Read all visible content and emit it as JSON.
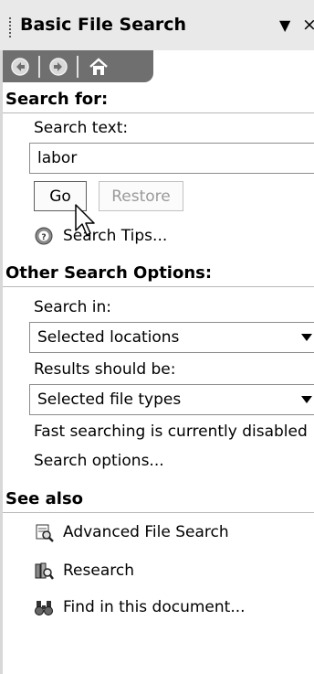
{
  "title_bar": {
    "title": "Basic File Search",
    "dropdown_glyph": "▼",
    "close_glyph": "×"
  },
  "nav": {
    "back_icon": "back-arrow-icon",
    "forward_icon": "forward-arrow-icon",
    "home_icon": "home-icon"
  },
  "search_for": {
    "header": "Search for:",
    "search_text_label": "Search text:",
    "search_text_value": "labor",
    "go_label": "Go",
    "restore_label": "Restore",
    "tips_label": "Search Tips..."
  },
  "other_options": {
    "header": "Other Search Options:",
    "search_in_label": "Search in:",
    "search_in_value": "Selected locations",
    "results_label": "Results should be:",
    "results_value": "Selected file types",
    "fast_search_status": "Fast searching is currently disabled",
    "search_options_link": "Search options..."
  },
  "see_also": {
    "header": "See also",
    "items": [
      {
        "label": "Advanced File Search",
        "icon": "advanced-search-icon"
      },
      {
        "label": "Research",
        "icon": "research-icon"
      },
      {
        "label": "Find in this document...",
        "icon": "binoculars-icon"
      }
    ]
  },
  "colors": {
    "nav_bar": "#6f6f6f",
    "title_bar": "#e9e9e9",
    "divider": "#b8b8b8"
  }
}
